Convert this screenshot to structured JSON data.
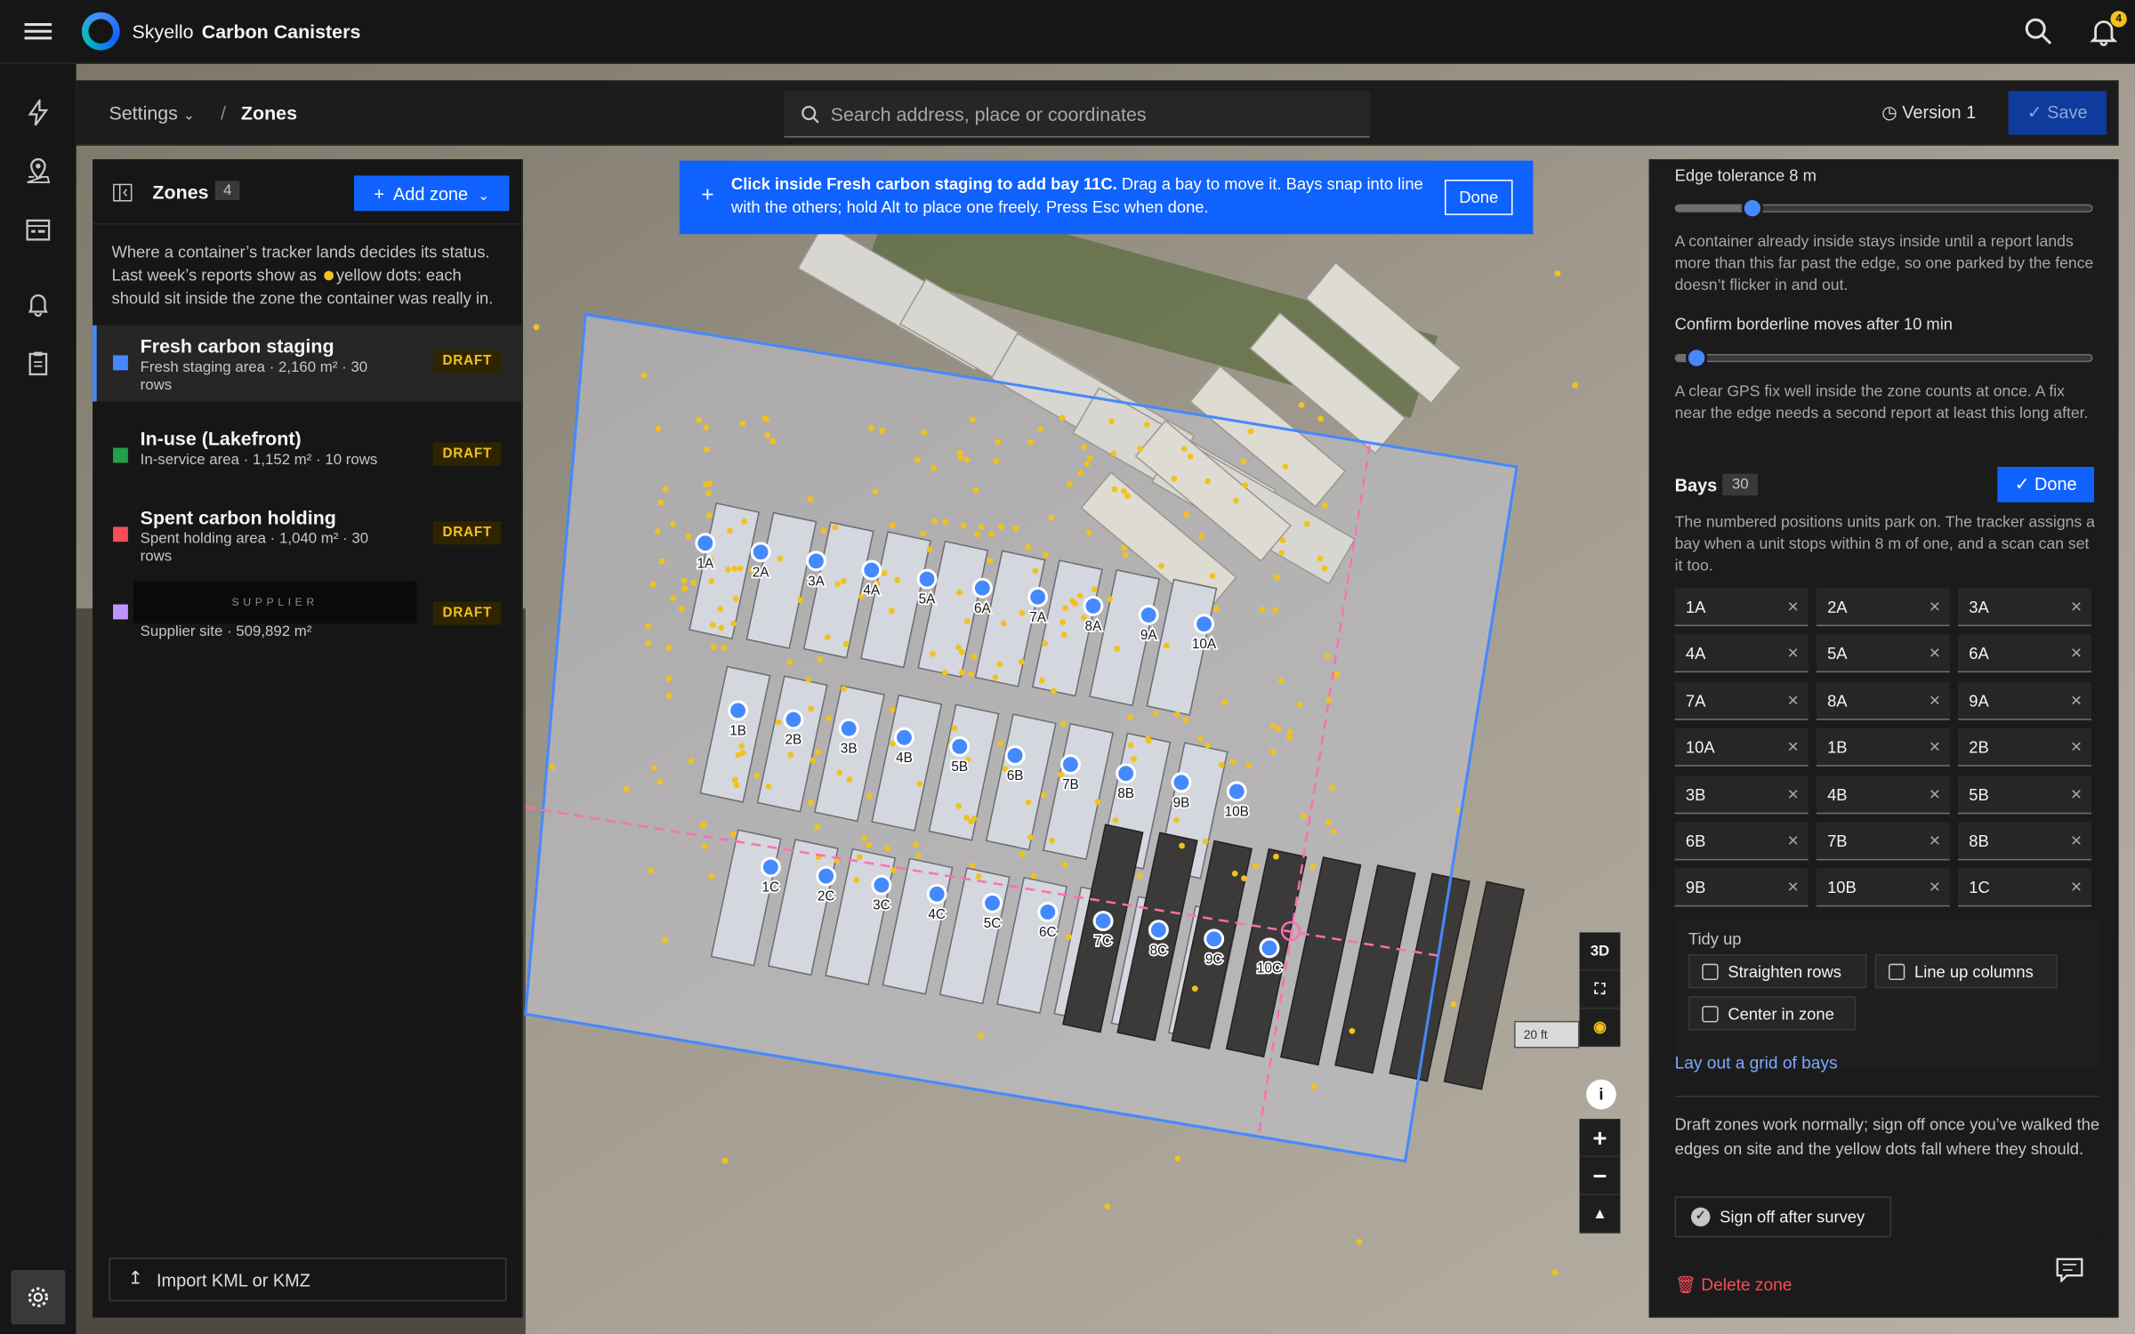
{
  "app": {
    "brand": "Skyello",
    "product": "Carbon Canisters",
    "notifications": "4"
  },
  "breadcrumb": {
    "parent": "Settings",
    "current": "Zones"
  },
  "search": {
    "placeholder": "Search address, place or coordinates"
  },
  "version": {
    "label": "Version 1"
  },
  "toolbar": {
    "save_label": "Save"
  },
  "zones_panel": {
    "title": "Zones",
    "count": "4",
    "add_label": "Add zone",
    "intro_1": "Where a container’s tracker lands decides its status. Last week’s reports show as",
    "intro_2": "yellow dots: each should sit inside the zone the container was really in.",
    "import_label": "Import KML or KMZ",
    "items": [
      {
        "name": "Fresh carbon staging",
        "detail": "Fresh staging area · 2,160 m² · 30 rows",
        "status": "DRAFT",
        "color": "#4589ff"
      },
      {
        "name": "In-use (Lakefront)",
        "detail": "In-service area · 1,152 m² · 10 rows",
        "status": "DRAFT",
        "color": "#24a148"
      },
      {
        "name": "Spent carbon holding",
        "detail": "Spent holding area · 1,040 m² · 30 rows",
        "status": "DRAFT",
        "color": "#fa4d56"
      },
      {
        "name": "SUPPLIER",
        "detail": "Supplier site · 509,892 m²",
        "status": "DRAFT",
        "color": "#be95ff"
      }
    ]
  },
  "banner": {
    "bold": "Click inside Fresh carbon staging to add bay 11C.",
    "text": " Drag a bay to move it. Bays snap into line with the others; hold Alt to place one freely. Press Esc when done.",
    "done_label": "Done"
  },
  "settings_panel": {
    "edge_label": "Edge tolerance 8 m",
    "edge_value_m": 8,
    "edge_help": "A container already inside stays inside until a report lands more than this far past the edge, so one parked by the fence doesn’t flicker in and out.",
    "confirm_label": "Confirm borderline moves after 10 min",
    "confirm_value_min": 10,
    "confirm_help": "A clear GPS fix well inside the zone counts at once. A fix near the edge needs a second report at least this long after.",
    "bays_title": "Bays",
    "bays_count": "30",
    "bays_done_label": "Done",
    "bays_help": "The numbered positions units park on. The tracker assigns a bay when a unit stops within 8 m of one, and a scan can set it too.",
    "bays": [
      "1A",
      "2A",
      "3A",
      "4A",
      "5A",
      "6A",
      "7A",
      "8A",
      "9A",
      "10A",
      "1B",
      "2B",
      "3B",
      "4B",
      "5B",
      "6B",
      "7B",
      "8B",
      "9B",
      "10B",
      "1C"
    ],
    "tidy_title": "Tidy up",
    "straighten_label": "Straighten rows",
    "lineup_label": "Line up columns",
    "center_label": "Center in zone",
    "grid_link": "Lay out a grid of bays",
    "draft_help": "Draft zones work normally; sign off once you’ve walked the edges on site and the yellow dots fall where they should.",
    "signoff_label": "Sign off after survey",
    "delete_label": "Delete zone"
  },
  "map": {
    "mode_label": "3D",
    "scale_label": "20 ft",
    "info_label": "i",
    "zoom_in": "+",
    "zoom_out": "−",
    "compass": "▲",
    "markers": [
      "1A",
      "2A",
      "3A",
      "4A",
      "5A",
      "6A",
      "7A",
      "8A",
      "9A",
      "10A",
      "1B",
      "2B",
      "3B",
      "4B",
      "5B",
      "6B",
      "7B",
      "8B",
      "9B",
      "10B",
      "1C",
      "2C",
      "3C",
      "4C",
      "5C",
      "6C",
      "7C",
      "8C",
      "9C",
      "10C"
    ]
  }
}
